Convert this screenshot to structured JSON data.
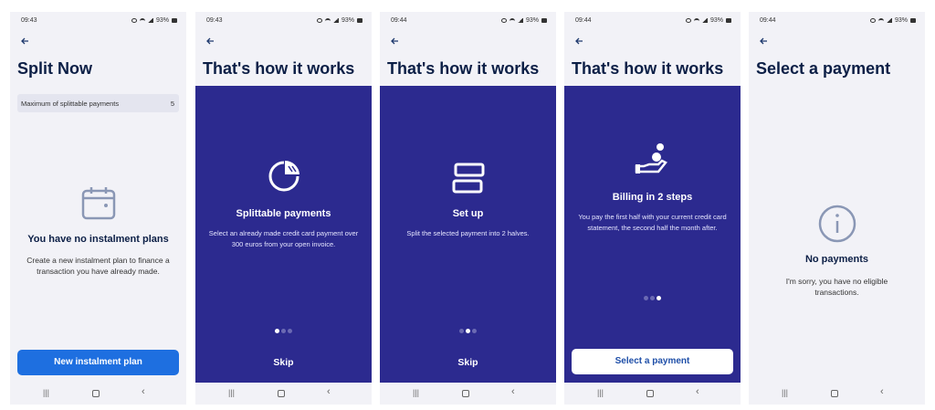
{
  "screens": [
    {
      "time": "09:43",
      "battery": "93%",
      "title": "Split Now",
      "max_label": "Maximum of splittable payments",
      "max_value": "5",
      "empty_title": "You have no instalment plans",
      "empty_text": "Create a new instalment plan to finance a transaction you have already made.",
      "button": "New instalment plan"
    },
    {
      "time": "09:43",
      "battery": "93%",
      "title": "That's how it works",
      "heading": "Splittable payments",
      "text": "Select an already made credit card payment over 300 euros from your open invoice.",
      "step": 1,
      "skip": "Skip"
    },
    {
      "time": "09:44",
      "battery": "93%",
      "title": "That's how it works",
      "heading": "Set up",
      "text": "Split the selected payment into 2 halves.",
      "step": 2,
      "skip": "Skip"
    },
    {
      "time": "09:44",
      "battery": "93%",
      "title": "That's how it works",
      "heading": "Billing in 2 steps",
      "text": "You pay the first half with your current credit card statement, the second half the month after.",
      "step": 3,
      "button": "Select a payment"
    },
    {
      "time": "09:44",
      "battery": "93%",
      "title": "Select a payment",
      "empty_title": "No payments",
      "empty_text": "I'm sorry, you have no eligible transactions."
    }
  ],
  "icons": {
    "back": "arrow-left-icon",
    "calendar": "calendar-icon",
    "pie": "pie-chart-icon",
    "split": "split-icon",
    "coins_hand": "hand-coins-icon",
    "info": "info-icon"
  },
  "colors": {
    "panel": "#2c2a8f",
    "primary_button": "#1e6fe0",
    "title": "#0c1f46"
  }
}
